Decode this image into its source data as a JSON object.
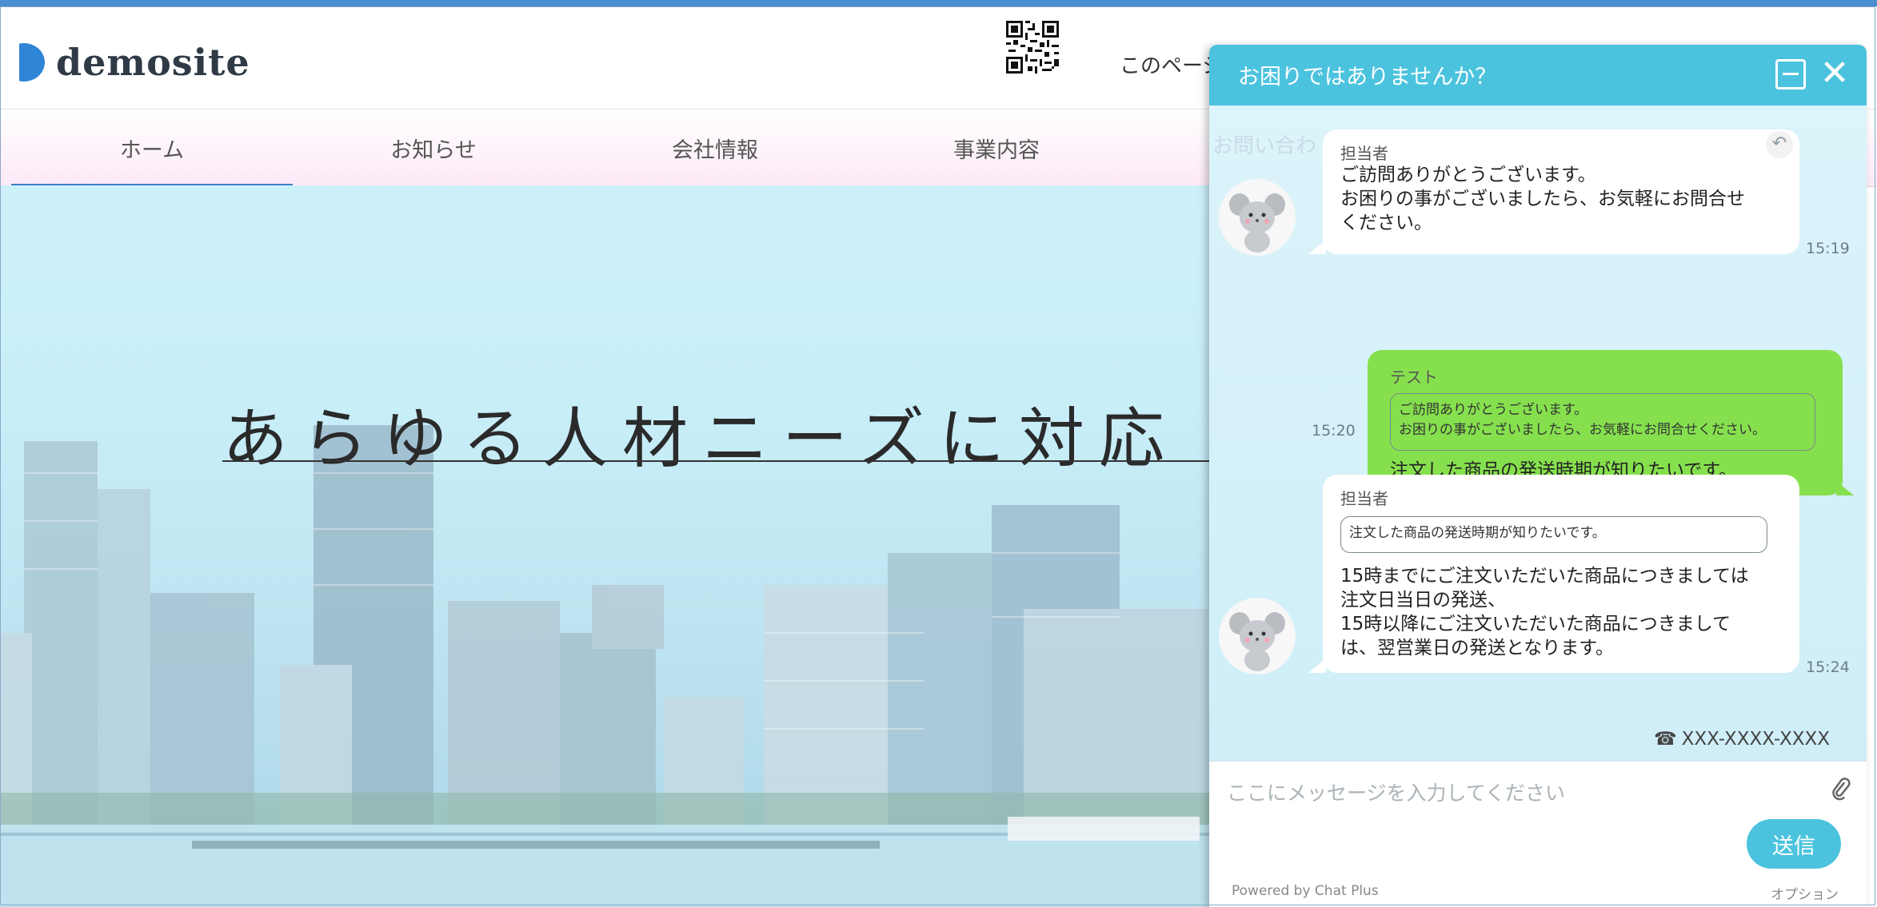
{
  "header": {
    "logo_text": "demosite",
    "demo_note": "このページはデモサイトです"
  },
  "nav": {
    "items": [
      {
        "label": "ホーム",
        "active": true
      },
      {
        "label": "お知らせ"
      },
      {
        "label": "会社情報"
      },
      {
        "label": "事業内容"
      },
      {
        "label": "お問い合わ"
      }
    ]
  },
  "hero": {
    "title": "あらゆる人材ニーズに対応"
  },
  "chat": {
    "title": "お困りではありませんか？",
    "messages": [
      {
        "side": "left",
        "sender": "担当者",
        "lines": [
          "ご訪問ありがとうございます。",
          "お困りの事がございましたら、お気軽にお問合せ",
          "ください。"
        ],
        "time": "15:19"
      },
      {
        "side": "right",
        "sender": "テスト",
        "quote": [
          "ご訪問ありがとうございます。",
          "お困りの事がございましたら、お気軽にお問合せください。"
        ],
        "lines": [
          "注文した商品の発送時期が知りたいです。"
        ],
        "time": "15:20"
      },
      {
        "side": "left",
        "sender": "担当者",
        "quote": [
          "注文した商品の発送時期が知りたいです。"
        ],
        "lines": [
          "15時までにご注文いただいた商品につきましては",
          "注文日当日の発送、",
          "15時以降にご注文いただいた商品につきまして",
          "は、翌営業日の発送となります。"
        ],
        "time": "15:24"
      }
    ],
    "phone": "XXX-XXXX-XXXX",
    "input_placeholder": "ここにメッセージを入力してください",
    "send_label": "送信",
    "powered_by": "Powered by Chat Plus",
    "options_label": "オプション"
  },
  "colors": {
    "accent": "#4bc3de",
    "user_bubble": "#86e04e",
    "nav_active": "#3d7fc9",
    "logo": "#2f86d6"
  }
}
